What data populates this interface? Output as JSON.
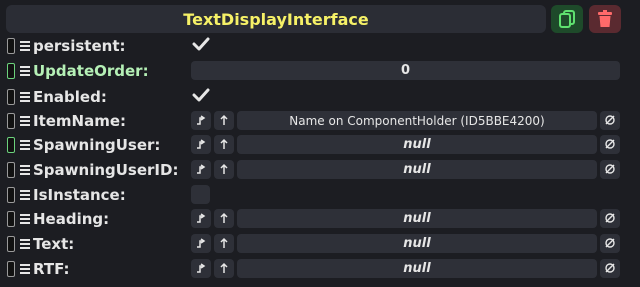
{
  "header": {
    "title": "TextDisplayInterface"
  },
  "fields": [
    {
      "label": "persistent:",
      "kind": "checkbox",
      "checked": true
    },
    {
      "label": "UpdateOrder:",
      "kind": "number",
      "value": "0",
      "highlight": true
    },
    {
      "label": "Enabled:",
      "kind": "checkbox",
      "checked": true
    },
    {
      "label": "ItemName:",
      "kind": "reference",
      "value": "Name on ComponentHolder (ID5BBE4200)"
    },
    {
      "label": "SpawningUser:",
      "kind": "reference",
      "value": "null",
      "highlight": true
    },
    {
      "label": "SpawningUserID:",
      "kind": "reference",
      "value": "null"
    },
    {
      "label": "IsInstance:",
      "kind": "checkbox",
      "checked": false
    },
    {
      "label": "Heading:",
      "kind": "reference",
      "value": "null"
    },
    {
      "label": "Text:",
      "kind": "reference",
      "value": "null"
    },
    {
      "label": "RTF:",
      "kind": "reference",
      "value": "null"
    }
  ],
  "colors": {
    "background": "#1c1d22",
    "title": "#f6f167",
    "highlight_label": "#b5f0b6",
    "duplicate_button": "#1e4a2a",
    "delete_button": "#5a2a30"
  },
  "icons": {
    "duplicate": "duplicate-icon",
    "delete": "trash-icon",
    "drive": "drive-icon",
    "jump": "jump-up-icon",
    "clear": "null-clear-icon"
  }
}
